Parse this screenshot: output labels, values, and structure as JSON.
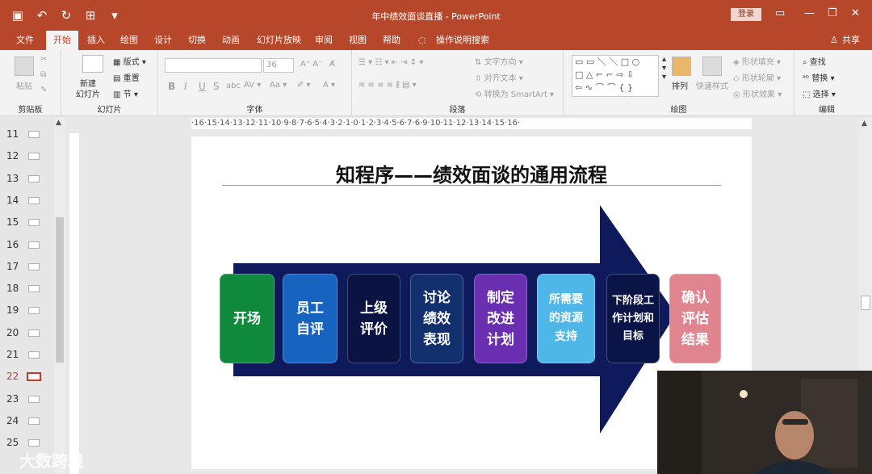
{
  "window": {
    "title": "年中绩效面谈直播 - PowerPoint",
    "login": "登录",
    "share": "共享"
  },
  "menu": {
    "items": [
      "文件",
      "开始",
      "插入",
      "绘图",
      "设计",
      "切换",
      "动画",
      "幻灯片放映",
      "审阅",
      "视图",
      "帮助",
      "操作说明搜索"
    ],
    "active": "开始"
  },
  "ribbon": {
    "clipboard": {
      "label": "剪贴板",
      "paste": "粘贴"
    },
    "slides": {
      "label": "幻灯片",
      "new_slide": "新建\n幻灯片",
      "layout": "版式",
      "reset": "重置",
      "section": "节"
    },
    "font": {
      "label": "字体",
      "size": "36"
    },
    "paragraph": {
      "label": "段落",
      "text_direction": "文字方向",
      "align_text": "对齐文本",
      "smartart": "转换为 SmartArt"
    },
    "drawing": {
      "label": "绘图",
      "arrange": "排列",
      "quick_styles": "快速样式",
      "shape_fill": "形状填充",
      "shape_outline": "形状轮廓",
      "shape_effects": "形状效果"
    },
    "editing": {
      "label": "编辑",
      "find": "查找",
      "replace": "替换",
      "select": "选择"
    }
  },
  "slides_panel": {
    "items": [
      "11",
      "12",
      "13",
      "14",
      "15",
      "16",
      "17",
      "18",
      "19",
      "20",
      "21",
      "22",
      "23",
      "24",
      "25"
    ],
    "current": "22"
  },
  "ruler": {
    "h": "·16·15·14·13·12·11·10·9·8·7·6·5·4·3·2·1·0·1·2·3·4·5·6·7·6·9·10·11·12·13·14·15·16·"
  },
  "slide": {
    "title": "知程序——绩效面谈的通用流程",
    "steps": [
      {
        "text": "开场",
        "color": "#0f8a3c"
      },
      {
        "text": "员工\n自评",
        "color": "#1664c0"
      },
      {
        "text": "上级\n评价",
        "color": "#0b1342"
      },
      {
        "text": "讨论\n绩效\n表现",
        "color": "#13306e"
      },
      {
        "text": "制定\n改进\n计划",
        "color": "#6a2fb0"
      },
      {
        "text": "所需要\n的资源\n支持",
        "color": "#4fb6e8"
      },
      {
        "text": "下阶段工\n作计划和\n目标",
        "color": "#0b1446"
      },
      {
        "text": "确认\n评估\n结果",
        "color": "#e0848f"
      }
    ],
    "arrow_color": "#0f1a5c"
  },
  "watermark": {
    "text": "大数跨境"
  }
}
